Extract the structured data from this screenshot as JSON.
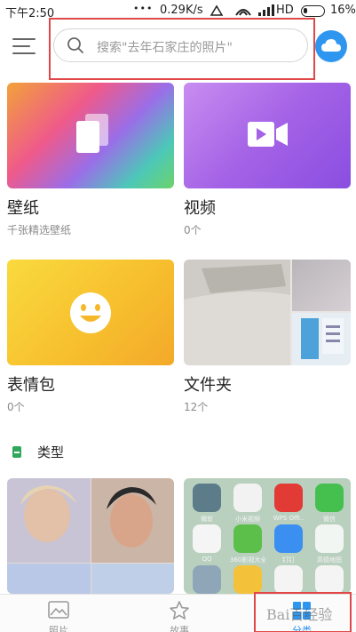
{
  "status_bar": {
    "time": "下午2:50",
    "dots": "•••",
    "network_speed": "0.29K/s",
    "network_type": "HD",
    "battery": "16%"
  },
  "header": {
    "menu_icon": "hamburger-menu-icon",
    "search_placeholder": "搜索\"去年石家庄的照片\"",
    "cloud_icon": "cloud-icon"
  },
  "cards": [
    {
      "title": "壁纸",
      "subtitle": "千张精选壁纸",
      "icon": "wallpaper-icon"
    },
    {
      "title": "视频",
      "subtitle": "0个",
      "icon": "video-camera-icon"
    },
    {
      "title": "表情包",
      "subtitle": "0个",
      "icon": "smiley-face-icon"
    },
    {
      "title": "文件夹",
      "subtitle": "12个"
    }
  ],
  "section": {
    "label": "类型"
  },
  "app_labels": [
    "微软",
    "小米视频",
    "WPS Offi..",
    "微信",
    "QQ",
    "360影视大全",
    "钉钉",
    "高德地图",
    "",
    "",
    "",
    ""
  ],
  "bottom_nav": [
    {
      "label": "照片",
      "icon": "photo-icon",
      "active": false
    },
    {
      "label": "故事",
      "icon": "star-icon",
      "active": false
    },
    {
      "label": "分类",
      "icon": "category-icon",
      "active": true
    }
  ],
  "watermark": "Bai百经验",
  "colors": {
    "cloud_accent": "#2f96f0",
    "highlight_red": "#e04848",
    "section_mark": "#2fa85a"
  }
}
